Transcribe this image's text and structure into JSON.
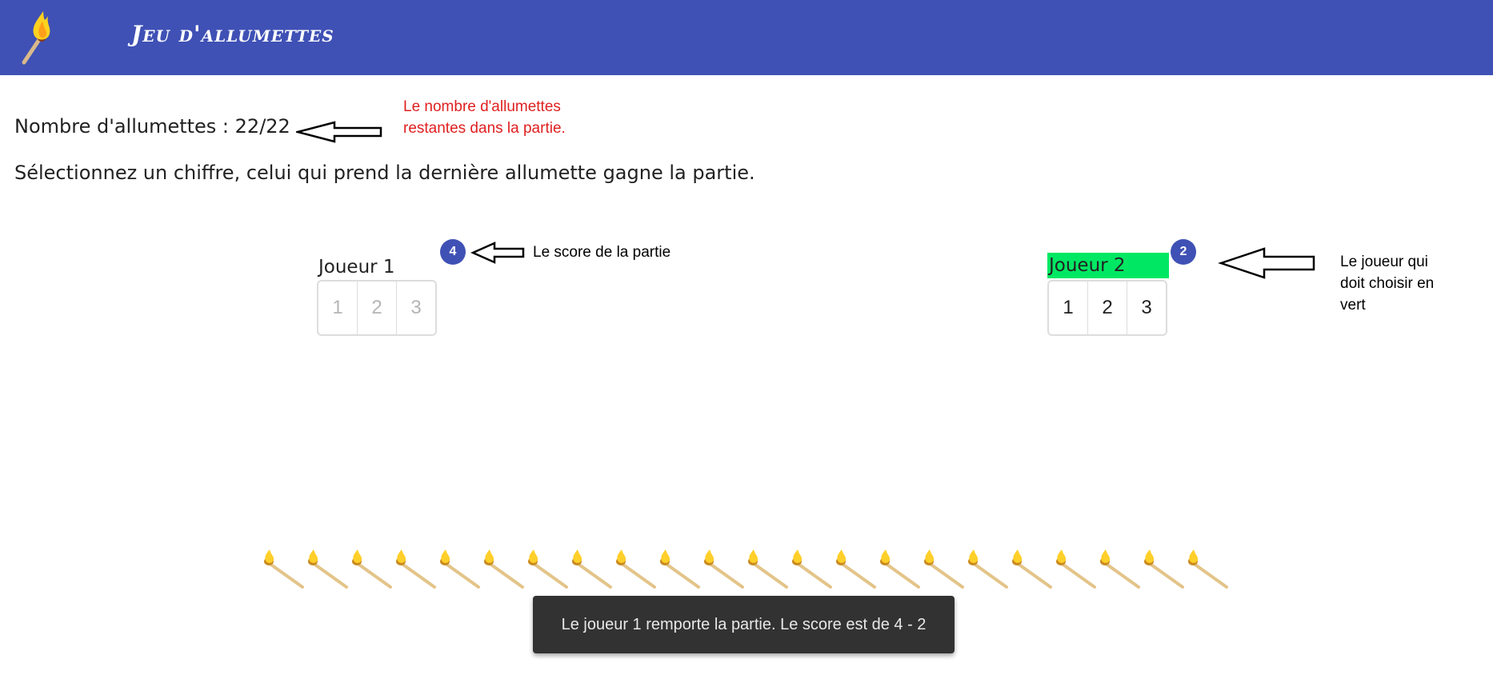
{
  "header": {
    "title": "Jeu d'allumettes",
    "logo_icon": "burning-match-icon",
    "background_color": "#3f51b5"
  },
  "game": {
    "count_label": "Nombre d'allumettes : 22/22",
    "instruction": "Sélectionnez un chiffre, celui qui prend la dernière allumette gagne la partie.",
    "remaining": 22,
    "total": 22
  },
  "players": [
    {
      "label": "Joueur 1",
      "score": "4",
      "active": false,
      "choices": [
        "1",
        "2",
        "3"
      ]
    },
    {
      "label": "Joueur 2",
      "score": "2",
      "active": true,
      "choices": [
        "1",
        "2",
        "3"
      ]
    }
  ],
  "annotations": {
    "remaining_note": "Le nombre d'allumettes\nrestantes dans la partie.",
    "score_note": "Le score de la partie",
    "active_player_note": "Le joueur qui\ndoit choisir en\nvert"
  },
  "colors": {
    "accent": "#3f51b5",
    "active_player": "#00e863",
    "annotation_red": "#e02020"
  },
  "matches": {
    "icon": "match-stick-icon",
    "count": 22
  },
  "snackbar": {
    "message": "Le joueur 1 remporte la partie. Le score est de 4 - 2"
  }
}
